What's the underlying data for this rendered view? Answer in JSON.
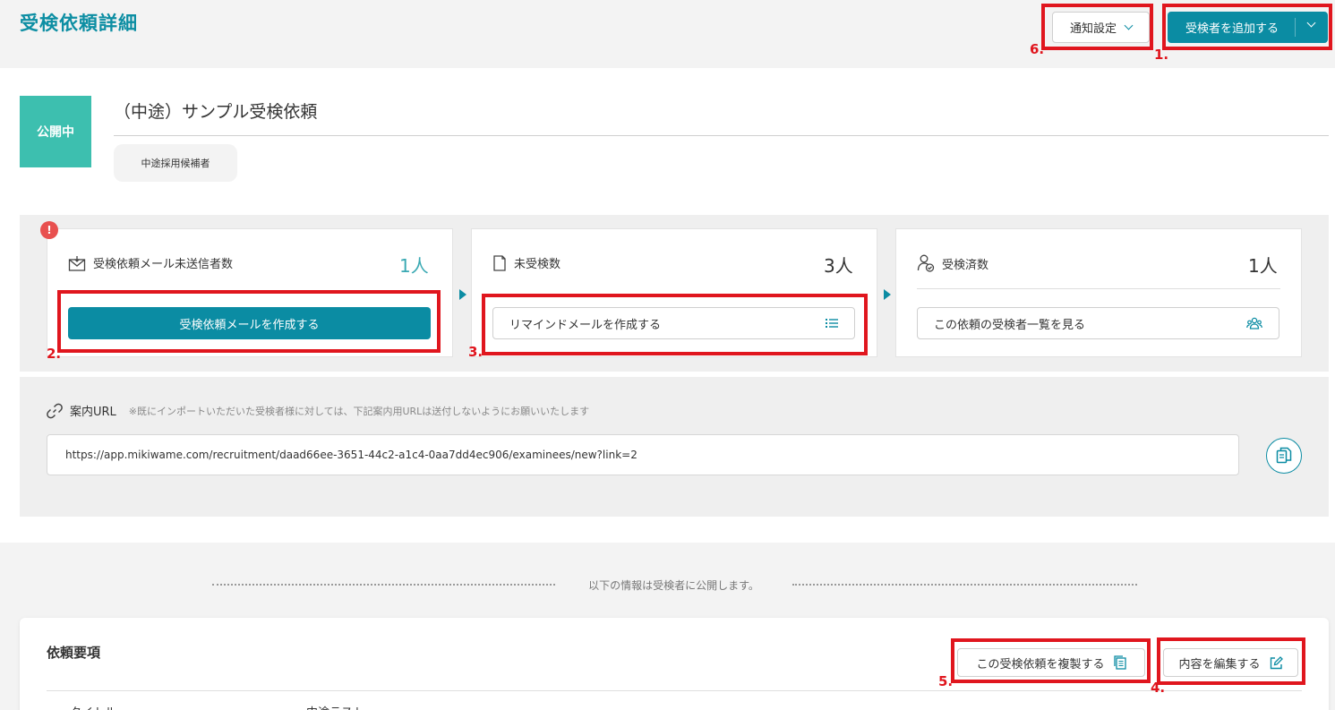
{
  "header": {
    "page_title": "受検依頼詳細",
    "notify_label": "通知設定",
    "add_examinee_label": "受検者を追加する"
  },
  "request": {
    "status": "公開中",
    "title": "（中途）サンプル受検依頼",
    "tag": "中途採用候補者"
  },
  "stats": {
    "alert": "!",
    "unsent": {
      "label": "受検依頼メール未送信者数",
      "value": "1人",
      "button": "受検依頼メールを作成する"
    },
    "not_taken": {
      "label": "未受検数",
      "value": "3人",
      "button": "リマインドメールを作成する"
    },
    "taken": {
      "label": "受検済数",
      "value": "1人",
      "button": "この依頼の受検者一覧を見る"
    }
  },
  "invite_url": {
    "label": "案内URL",
    "note": "※既にインポートいただいた受検者様に対しては、下記案内用URLは送付しないようにお願いいたします",
    "value": "https://app.mikiwame.com/recruitment/daad66ee-3651-44c2-a1c4-0aa7dd4ec906/examinees/new?link=2"
  },
  "public_note": "以下の情報は受検者に公開します。",
  "requirements": {
    "heading": "依頼要項",
    "duplicate_label": "この受検依頼を複製する",
    "edit_label": "内容を編集する",
    "row_label": "タイトル",
    "row_value": "中途テスト"
  },
  "annotations": {
    "m1": "1.",
    "m2": "2.",
    "m3": "3.",
    "m4": "4.",
    "m5": "5.",
    "m6": "6."
  },
  "colors": {
    "accent": "#0b8ca3",
    "status": "#3dbfaf",
    "highlight": "#e0161e"
  }
}
